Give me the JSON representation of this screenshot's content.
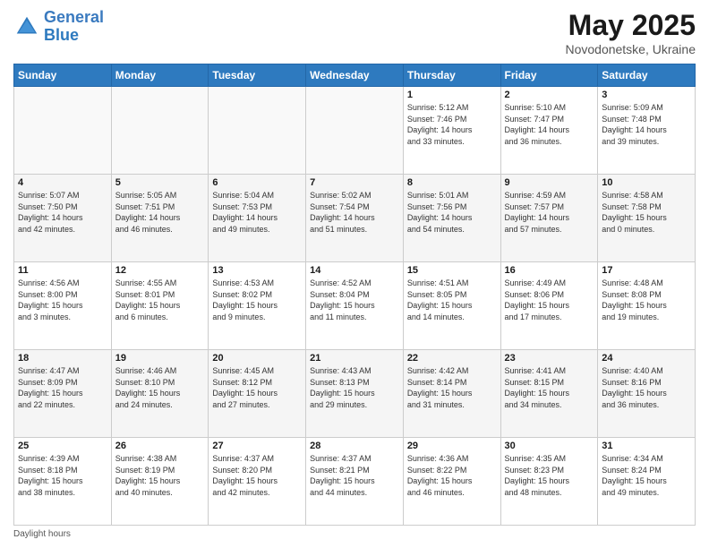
{
  "header": {
    "logo_line1": "General",
    "logo_line2": "Blue",
    "main_title": "May 2025",
    "subtitle": "Novodonetske, Ukraine"
  },
  "days_of_week": [
    "Sunday",
    "Monday",
    "Tuesday",
    "Wednesday",
    "Thursday",
    "Friday",
    "Saturday"
  ],
  "weeks": [
    [
      {
        "day": "",
        "info": ""
      },
      {
        "day": "",
        "info": ""
      },
      {
        "day": "",
        "info": ""
      },
      {
        "day": "",
        "info": ""
      },
      {
        "day": "1",
        "info": "Sunrise: 5:12 AM\nSunset: 7:46 PM\nDaylight: 14 hours\nand 33 minutes."
      },
      {
        "day": "2",
        "info": "Sunrise: 5:10 AM\nSunset: 7:47 PM\nDaylight: 14 hours\nand 36 minutes."
      },
      {
        "day": "3",
        "info": "Sunrise: 5:09 AM\nSunset: 7:48 PM\nDaylight: 14 hours\nand 39 minutes."
      }
    ],
    [
      {
        "day": "4",
        "info": "Sunrise: 5:07 AM\nSunset: 7:50 PM\nDaylight: 14 hours\nand 42 minutes."
      },
      {
        "day": "5",
        "info": "Sunrise: 5:05 AM\nSunset: 7:51 PM\nDaylight: 14 hours\nand 46 minutes."
      },
      {
        "day": "6",
        "info": "Sunrise: 5:04 AM\nSunset: 7:53 PM\nDaylight: 14 hours\nand 49 minutes."
      },
      {
        "day": "7",
        "info": "Sunrise: 5:02 AM\nSunset: 7:54 PM\nDaylight: 14 hours\nand 51 minutes."
      },
      {
        "day": "8",
        "info": "Sunrise: 5:01 AM\nSunset: 7:56 PM\nDaylight: 14 hours\nand 54 minutes."
      },
      {
        "day": "9",
        "info": "Sunrise: 4:59 AM\nSunset: 7:57 PM\nDaylight: 14 hours\nand 57 minutes."
      },
      {
        "day": "10",
        "info": "Sunrise: 4:58 AM\nSunset: 7:58 PM\nDaylight: 15 hours\nand 0 minutes."
      }
    ],
    [
      {
        "day": "11",
        "info": "Sunrise: 4:56 AM\nSunset: 8:00 PM\nDaylight: 15 hours\nand 3 minutes."
      },
      {
        "day": "12",
        "info": "Sunrise: 4:55 AM\nSunset: 8:01 PM\nDaylight: 15 hours\nand 6 minutes."
      },
      {
        "day": "13",
        "info": "Sunrise: 4:53 AM\nSunset: 8:02 PM\nDaylight: 15 hours\nand 9 minutes."
      },
      {
        "day": "14",
        "info": "Sunrise: 4:52 AM\nSunset: 8:04 PM\nDaylight: 15 hours\nand 11 minutes."
      },
      {
        "day": "15",
        "info": "Sunrise: 4:51 AM\nSunset: 8:05 PM\nDaylight: 15 hours\nand 14 minutes."
      },
      {
        "day": "16",
        "info": "Sunrise: 4:49 AM\nSunset: 8:06 PM\nDaylight: 15 hours\nand 17 minutes."
      },
      {
        "day": "17",
        "info": "Sunrise: 4:48 AM\nSunset: 8:08 PM\nDaylight: 15 hours\nand 19 minutes."
      }
    ],
    [
      {
        "day": "18",
        "info": "Sunrise: 4:47 AM\nSunset: 8:09 PM\nDaylight: 15 hours\nand 22 minutes."
      },
      {
        "day": "19",
        "info": "Sunrise: 4:46 AM\nSunset: 8:10 PM\nDaylight: 15 hours\nand 24 minutes."
      },
      {
        "day": "20",
        "info": "Sunrise: 4:45 AM\nSunset: 8:12 PM\nDaylight: 15 hours\nand 27 minutes."
      },
      {
        "day": "21",
        "info": "Sunrise: 4:43 AM\nSunset: 8:13 PM\nDaylight: 15 hours\nand 29 minutes."
      },
      {
        "day": "22",
        "info": "Sunrise: 4:42 AM\nSunset: 8:14 PM\nDaylight: 15 hours\nand 31 minutes."
      },
      {
        "day": "23",
        "info": "Sunrise: 4:41 AM\nSunset: 8:15 PM\nDaylight: 15 hours\nand 34 minutes."
      },
      {
        "day": "24",
        "info": "Sunrise: 4:40 AM\nSunset: 8:16 PM\nDaylight: 15 hours\nand 36 minutes."
      }
    ],
    [
      {
        "day": "25",
        "info": "Sunrise: 4:39 AM\nSunset: 8:18 PM\nDaylight: 15 hours\nand 38 minutes."
      },
      {
        "day": "26",
        "info": "Sunrise: 4:38 AM\nSunset: 8:19 PM\nDaylight: 15 hours\nand 40 minutes."
      },
      {
        "day": "27",
        "info": "Sunrise: 4:37 AM\nSunset: 8:20 PM\nDaylight: 15 hours\nand 42 minutes."
      },
      {
        "day": "28",
        "info": "Sunrise: 4:37 AM\nSunset: 8:21 PM\nDaylight: 15 hours\nand 44 minutes."
      },
      {
        "day": "29",
        "info": "Sunrise: 4:36 AM\nSunset: 8:22 PM\nDaylight: 15 hours\nand 46 minutes."
      },
      {
        "day": "30",
        "info": "Sunrise: 4:35 AM\nSunset: 8:23 PM\nDaylight: 15 hours\nand 48 minutes."
      },
      {
        "day": "31",
        "info": "Sunrise: 4:34 AM\nSunset: 8:24 PM\nDaylight: 15 hours\nand 49 minutes."
      }
    ]
  ],
  "footer": "Daylight hours"
}
